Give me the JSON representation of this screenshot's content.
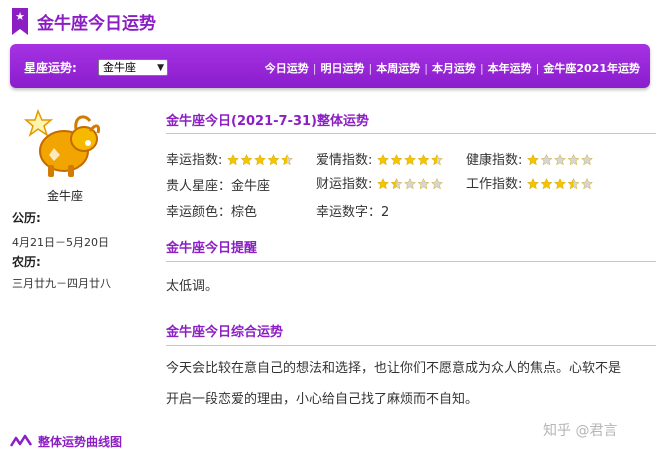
{
  "header": {
    "title": "金牛座今日运势",
    "bookmark_icon": "star-icon"
  },
  "navbar": {
    "label": "星座运势:",
    "selected_sign": "金牛座",
    "links": [
      "今日运势",
      "明日运势",
      "本周运势",
      "本月运势",
      "本年运势",
      "金牛座2021年运势"
    ]
  },
  "sidebar": {
    "sign_name": "金牛座",
    "gregorian_label": "公历:",
    "gregorian_range": "4月21日－5月20日",
    "lunar_label": "农历:",
    "lunar_range": "三月廿九－四月廿八"
  },
  "overview": {
    "title": "金牛座今日(2021-7-31)整体运势",
    "luck_index_label": "幸运指数:",
    "luck_index": 4.5,
    "love_index_label": "爱情指数:",
    "love_index": 4.5,
    "health_index_label": "健康指数:",
    "health_index": 1,
    "noble_sign_label": "贵人星座：",
    "noble_sign": "金牛座",
    "wealth_index_label": "财运指数:",
    "wealth_index": 1.5,
    "work_index_label": "工作指数:",
    "work_index": 3.5,
    "lucky_color_label": "幸运颜色：",
    "lucky_color": "棕色",
    "lucky_number_label": "幸运数字：",
    "lucky_number": "2",
    "star_color": "#f5c400",
    "star_empty_color": "#d6d6d6"
  },
  "reminder": {
    "title": "金牛座今日提醒",
    "text": "太低调。"
  },
  "summary": {
    "title": "金牛座今日综合运势",
    "line1": "今天会比较在意自己的想法和选择，也让你们不愿意成为众人的焦点。心软不是",
    "line2": "开启一段恋爱的理由，小心给自己找了麻烦而不自知。"
  },
  "footer": {
    "title": "整体运势曲线图",
    "icon": "line-chart-icon"
  },
  "watermark": "知乎 @君言"
}
